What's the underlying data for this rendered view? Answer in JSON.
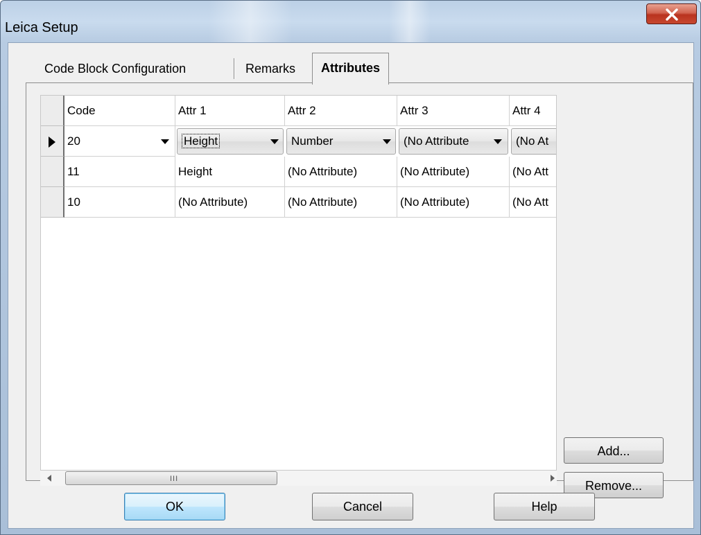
{
  "window": {
    "title": "Leica Setup"
  },
  "tabs": [
    {
      "label": "Code Block Configuration"
    },
    {
      "label": "Remarks"
    },
    {
      "label": "Attributes"
    }
  ],
  "grid": {
    "columns": [
      "Code",
      "Attr 1",
      "Attr 2",
      "Attr 3",
      "Attr 4"
    ],
    "rows": [
      {
        "cells": [
          "20",
          "Height",
          "Number",
          "(No Attribute",
          "(No At"
        ],
        "editing": true
      },
      {
        "cells": [
          "11",
          "Height",
          "(No Attribute)",
          "(No Attribute)",
          "(No Att"
        ],
        "editing": false
      },
      {
        "cells": [
          "10",
          "(No Attribute)",
          "(No Attribute)",
          "(No Attribute)",
          "(No Att"
        ],
        "editing": false
      }
    ]
  },
  "scrollbar": {
    "grip": "III"
  },
  "side_buttons": {
    "add": "Add...",
    "remove": "Remove..."
  },
  "footer": {
    "ok": "OK",
    "cancel": "Cancel",
    "help": "Help"
  },
  "icons": {
    "close": "close-icon",
    "row_pointer": "triangle-right-icon",
    "dropdown": "chevron-down-icon"
  },
  "colors": {
    "close_button": "#c7472f",
    "titlebar": "#bcd0e6",
    "default_button_border": "#3c7fb1"
  }
}
